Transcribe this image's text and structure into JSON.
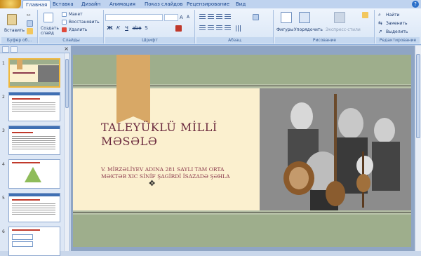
{
  "ribbon": {
    "tabs": [
      "Главная",
      "Вставка",
      "Дизайн",
      "Анимация",
      "Показ слайдов",
      "Рецензирование",
      "Вид"
    ],
    "clipboard": {
      "paste": "Вставить",
      "group": "Буфер об..."
    },
    "slides": {
      "new_slide": "Создать слайд",
      "layout": "Макет",
      "reset": "Восстановить",
      "delete": "Удалить",
      "group": "Слайды"
    },
    "font": {
      "group": "Шрифт",
      "bold": "Ж",
      "italic": "К",
      "underline": "Ч",
      "strike": "abe",
      "shadow": "S"
    },
    "paragraph": {
      "group": "Абзац"
    },
    "drawing": {
      "shapes": "Фигуры",
      "arrange": "Упорядочить",
      "quick_styles": "Экспресс-стили",
      "group": "Рисование"
    },
    "editing": {
      "find": "Найти",
      "replace": "Заменить",
      "select": "Выделить",
      "group": "Редактирование"
    }
  },
  "panel": {
    "slide_numbers": [
      "1",
      "2",
      "3",
      "4",
      "5",
      "6"
    ]
  },
  "slide": {
    "title_line1": "TALEYÜKLÜ MİLLİ",
    "title_line2": "MƏSƏLƏ",
    "subtitle_line1": "V. MİRZƏLİYEV ADINA 281 SAYLI TAM ORTA",
    "subtitle_line2": "MƏKTƏB XIC SİNİF ŞAGİRDİ İSAZADƏ ŞƏHLA"
  }
}
